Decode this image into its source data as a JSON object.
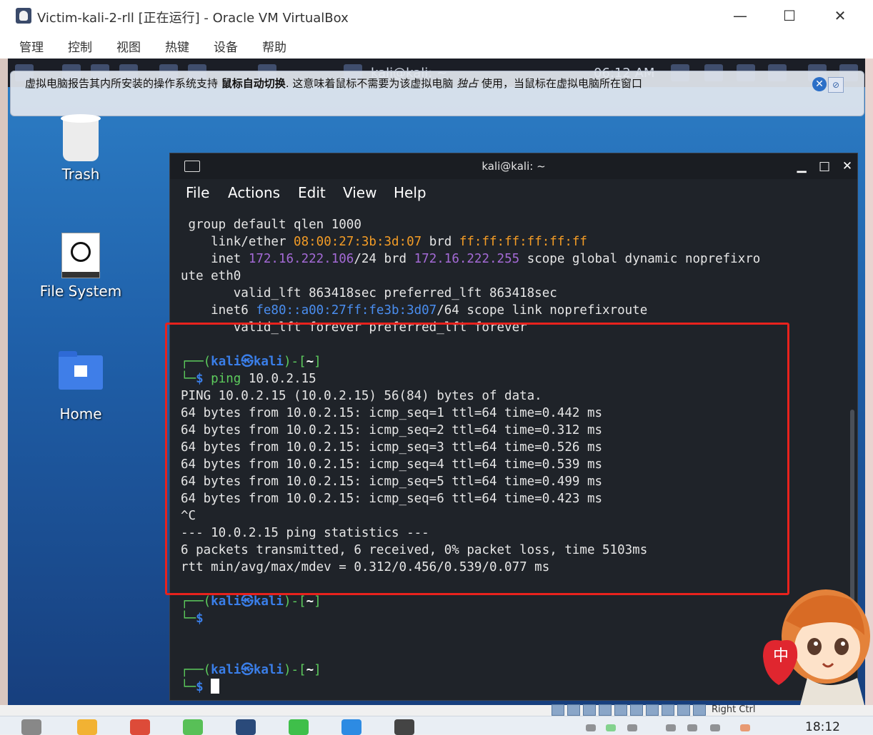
{
  "host_window": {
    "title": "Victim-kali-2-rll [正在运行] - Oracle VM VirtualBox",
    "menu": [
      "管理",
      "控制",
      "视图",
      "热键",
      "设备",
      "帮助"
    ]
  },
  "guest_panel": {
    "window_label": "kali@kali: ~",
    "clock": "06:12 AM"
  },
  "vbox_notification": {
    "text_before": "虚拟电脑报告其内所安装的操作系统支持",
    "bold_text": "鼠标自动切换",
    "text_middle": ". 这意味着鼠标不需要为该虚拟电脑",
    "italic_text": "独占",
    "text_after": "使用，当鼠标在虚拟电脑所在窗口"
  },
  "desktop_icons": [
    {
      "label": "Trash"
    },
    {
      "label": "File System"
    },
    {
      "label": "Home"
    }
  ],
  "terminal": {
    "title": "kali@kali: ~",
    "menu": [
      "File",
      "Actions",
      "Edit",
      "View",
      "Help"
    ],
    "header_lines": {
      "l1": " group default qlen 1000",
      "l2_prefix": "    link/ether ",
      "mac": "08:00:27:3b:3d:07",
      "l2_mid": " brd ",
      "mac_brd": "ff:ff:ff:ff:ff:ff",
      "l3_prefix": "    inet ",
      "inet": "172.16.222.106",
      "l3_mid": "/24 brd ",
      "inet_brd": "172.16.222.255",
      "l3_suffix": " scope global dynamic noprefixro",
      "l4": "ute eth0",
      "l5": "       valid_lft 863418sec preferred_lft 863418sec",
      "l6_prefix": "    inet6 ",
      "inet6": "fe80::a00:27ff:fe3b:3d07",
      "l6_suffix": "/64 scope link noprefixroute",
      "l7": "       valid_lft forever preferred_lft forever"
    },
    "prompt_user": "kali",
    "prompt_symbol": "㉿",
    "prompt_host": "kali",
    "prompt_dir": "~",
    "command_name": "ping",
    "command_arg": " 10.0.2.15",
    "output": [
      "PING 10.0.2.15 (10.0.2.15) 56(84) bytes of data.",
      "64 bytes from 10.0.2.15: icmp_seq=1 ttl=64 time=0.442 ms",
      "64 bytes from 10.0.2.15: icmp_seq=2 ttl=64 time=0.312 ms",
      "64 bytes from 10.0.2.15: icmp_seq=3 ttl=64 time=0.526 ms",
      "64 bytes from 10.0.2.15: icmp_seq=4 ttl=64 time=0.539 ms",
      "64 bytes from 10.0.2.15: icmp_seq=5 ttl=64 time=0.499 ms",
      "64 bytes from 10.0.2.15: icmp_seq=6 ttl=64 time=0.423 ms",
      "^C",
      "--- 10.0.2.15 ping statistics ---",
      "6 packets transmitted, 6 received, 0% packet loss, time 5103ms",
      "rtt min/avg/max/mdev = 0.312/0.456/0.539/0.077 ms"
    ]
  },
  "vbox_status": {
    "host_key": "Right Ctrl"
  },
  "taskbar": {
    "time": "18:12"
  },
  "colors": {
    "highlight_box": "#e8221d",
    "terminal_bg": "#1f2329",
    "mac_orange": "#f39c26",
    "ip_purple": "#a46ad6",
    "ipv6_blue": "#4a8ef0"
  }
}
